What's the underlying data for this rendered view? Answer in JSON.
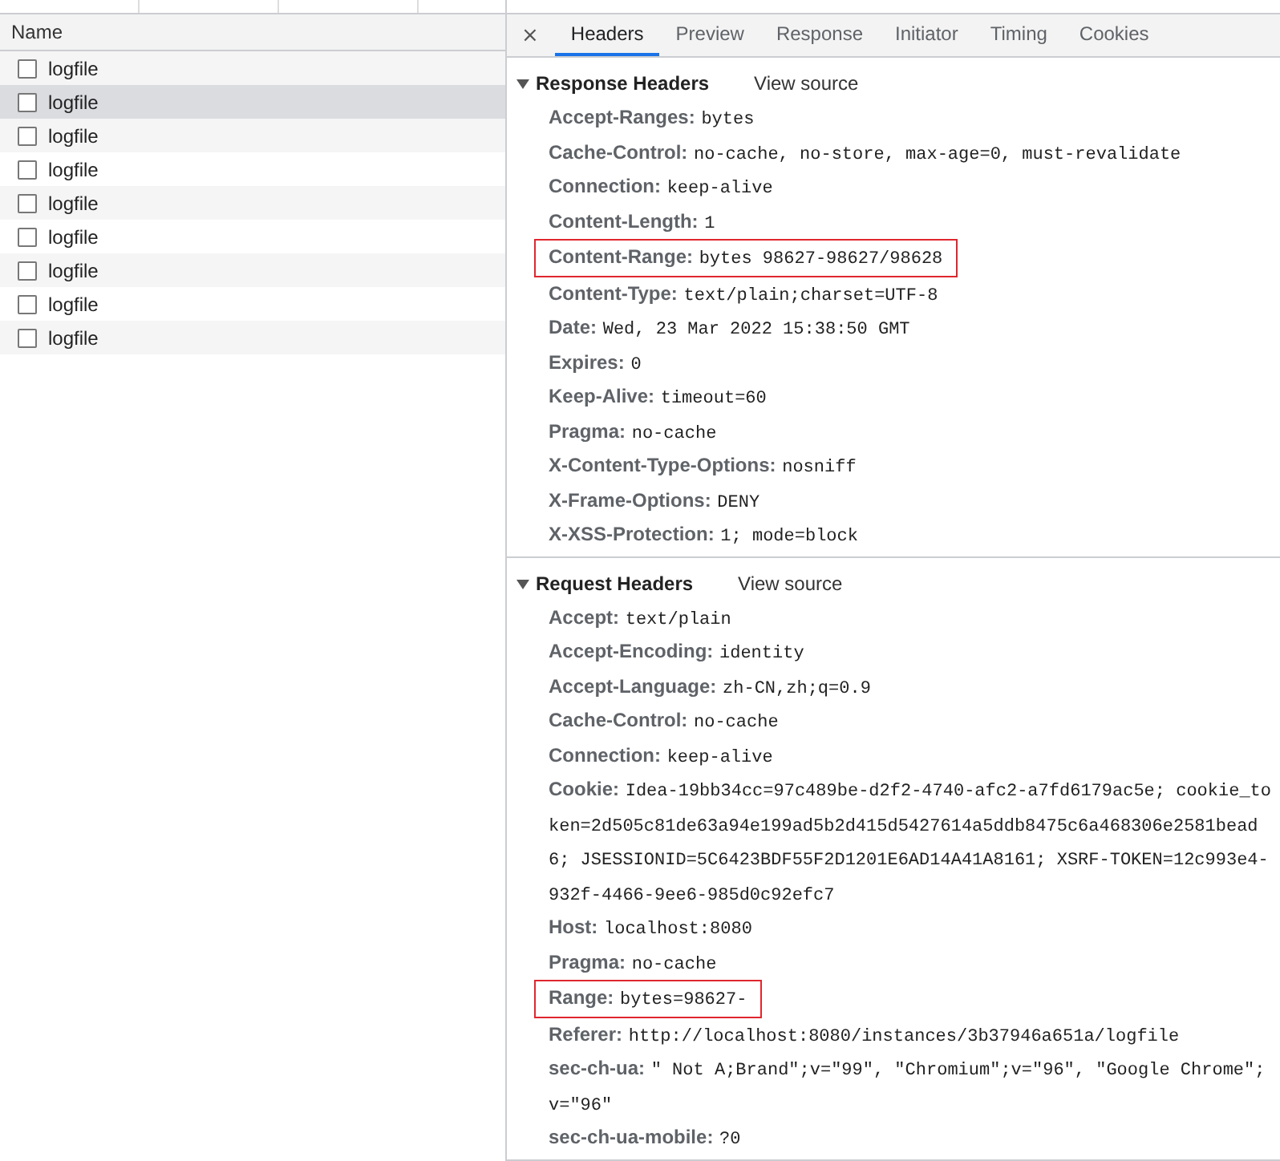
{
  "requests": {
    "column": "Name",
    "rows": [
      {
        "name": "logfile",
        "selected": false,
        "checked": false
      },
      {
        "name": "logfile",
        "selected": true,
        "checked": false
      },
      {
        "name": "logfile",
        "selected": false,
        "checked": false
      },
      {
        "name": "logfile",
        "selected": false,
        "checked": false
      },
      {
        "name": "logfile",
        "selected": false,
        "checked": false
      },
      {
        "name": "logfile",
        "selected": false,
        "checked": false
      },
      {
        "name": "logfile",
        "selected": false,
        "checked": false
      },
      {
        "name": "logfile",
        "selected": false,
        "checked": false
      },
      {
        "name": "logfile",
        "selected": false,
        "checked": false
      }
    ]
  },
  "detail": {
    "close": "×",
    "tabs": [
      {
        "label": "Headers",
        "selected": true
      },
      {
        "label": "Preview",
        "selected": false
      },
      {
        "label": "Response",
        "selected": false
      },
      {
        "label": "Initiator",
        "selected": false
      },
      {
        "label": "Timing",
        "selected": false
      },
      {
        "label": "Cookies",
        "selected": false
      }
    ],
    "sections": [
      {
        "title": "Response Headers",
        "expanded": true,
        "link": "View source",
        "headers": [
          {
            "name": "Accept-Ranges:",
            "value": "bytes",
            "highlighted": false
          },
          {
            "name": "Cache-Control:",
            "value": "no-cache, no-store, max-age=0, must-revalidate",
            "highlighted": false
          },
          {
            "name": "Connection:",
            "value": "keep-alive",
            "highlighted": false
          },
          {
            "name": "Content-Length:",
            "value": "1",
            "highlighted": false
          },
          {
            "name": "Content-Range:",
            "value": "bytes 98627-98627/98628",
            "highlighted": true
          },
          {
            "name": "Content-Type:",
            "value": "text/plain;charset=UTF-8",
            "highlighted": false
          },
          {
            "name": "Date:",
            "value": "Wed, 23 Mar 2022 15:38:50 GMT",
            "highlighted": false
          },
          {
            "name": "Expires:",
            "value": "0",
            "highlighted": false
          },
          {
            "name": "Keep-Alive:",
            "value": "timeout=60",
            "highlighted": false
          },
          {
            "name": "Pragma:",
            "value": "no-cache",
            "highlighted": false
          },
          {
            "name": "X-Content-Type-Options:",
            "value": "nosniff",
            "highlighted": false
          },
          {
            "name": "X-Frame-Options:",
            "value": "DENY",
            "highlighted": false
          },
          {
            "name": "X-XSS-Protection:",
            "value": "1; mode=block",
            "highlighted": false
          }
        ]
      },
      {
        "title": "Request Headers",
        "expanded": true,
        "link": "View source",
        "headers": [
          {
            "name": "Accept:",
            "value": "text/plain",
            "highlighted": false
          },
          {
            "name": "Accept-Encoding:",
            "value": "identity",
            "highlighted": false
          },
          {
            "name": "Accept-Language:",
            "value": "zh-CN,zh;q=0.9",
            "highlighted": false
          },
          {
            "name": "Cache-Control:",
            "value": "no-cache",
            "highlighted": false
          },
          {
            "name": "Connection:",
            "value": "keep-alive",
            "highlighted": false
          },
          {
            "name": "Cookie:",
            "value": "Idea-19bb34cc=97c489be-d2f2-4740-afc2-a7fd6179ac5e; cookie_token=2d505c81de63a94e199ad5b2d415d5427614a5ddb8475c6a468306e2581bead6; JSESSIONID=5C6423BDF55F2D1201E6AD14A41A8161; XSRF-TOKEN=12c993e4-932f-4466-9ee6-985d0c92efc7",
            "highlighted": false
          },
          {
            "name": "Host:",
            "value": "localhost:8080",
            "highlighted": false
          },
          {
            "name": "Pragma:",
            "value": "no-cache",
            "highlighted": false
          },
          {
            "name": "Range:",
            "value": "bytes=98627-",
            "highlighted": true
          },
          {
            "name": "Referer:",
            "value": "http://localhost:8080/instances/3b37946a651a/logfile",
            "highlighted": false
          },
          {
            "name": "sec-ch-ua:",
            "value": "\" Not A;Brand\";v=\"99\", \"Chromium\";v=\"96\", \"Google Chrome\";v=\"96\"",
            "highlighted": false
          },
          {
            "name": "sec-ch-ua-mobile:",
            "value": "?0",
            "highlighted": false
          }
        ]
      }
    ]
  }
}
